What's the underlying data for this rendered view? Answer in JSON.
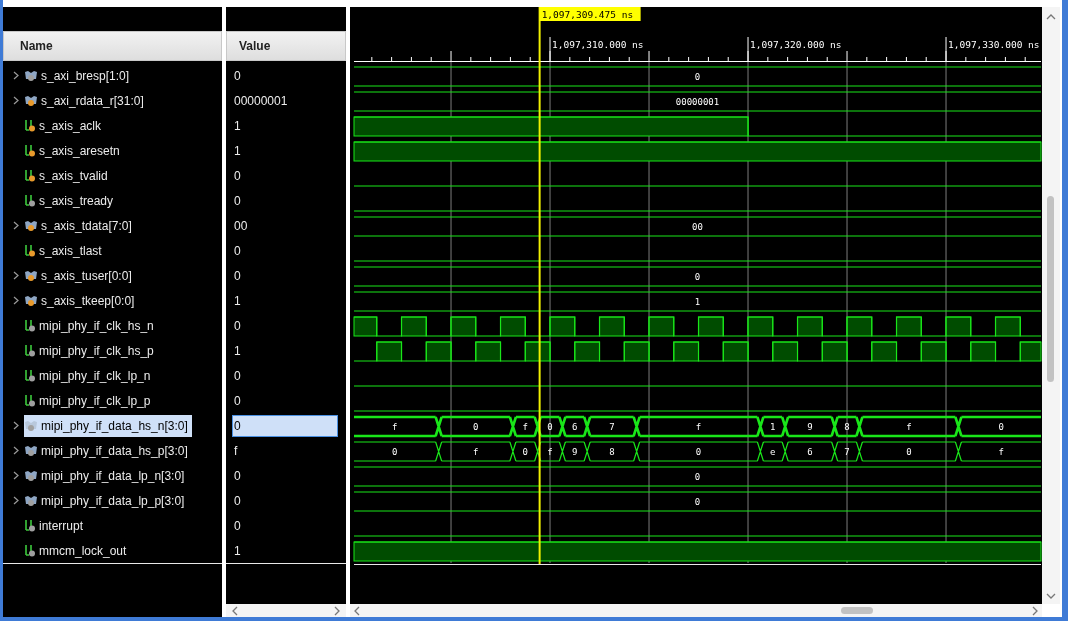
{
  "columns": [
    "Name",
    "Value"
  ],
  "cursor": {
    "label": "1,097,309.475 ns"
  },
  "ruler": [
    "1,097,310.000 ns",
    "1,097,320.000 ns",
    "1,097,330.000 ns"
  ],
  "signals": [
    {
      "name": "s_axi_bresp[1:0]",
      "value": "0",
      "kind": "bus",
      "expanded": false,
      "selected": false,
      "color": "#a0a0a0",
      "segments": [
        "0"
      ]
    },
    {
      "name": "s_axi_rdata_r[31:0]",
      "value": "00000001",
      "kind": "bus",
      "expanded": false,
      "selected": false,
      "color": "#e89a2c",
      "segments": [
        "00000001"
      ]
    },
    {
      "name": "s_axis_aclk",
      "value": "1",
      "kind": "bit",
      "selected": false,
      "color": "#e89a2c"
    },
    {
      "name": "s_axis_aresetn",
      "value": "1",
      "kind": "bit",
      "selected": false,
      "color": "#e89a2c"
    },
    {
      "name": "s_axis_tvalid",
      "value": "0",
      "kind": "bit",
      "selected": false,
      "color": "#e89a2c"
    },
    {
      "name": "s_axis_tready",
      "value": "0",
      "kind": "bit",
      "selected": false,
      "color": "#a0a0a0"
    },
    {
      "name": "s_axis_tdata[7:0]",
      "value": "00",
      "kind": "bus",
      "expanded": false,
      "selected": false,
      "color": "#e89a2c",
      "segments": [
        "00"
      ]
    },
    {
      "name": "s_axis_tlast",
      "value": "0",
      "kind": "bit",
      "selected": false,
      "color": "#e89a2c"
    },
    {
      "name": "s_axis_tuser[0:0]",
      "value": "0",
      "kind": "bus",
      "expanded": false,
      "selected": false,
      "color": "#e89a2c",
      "segments": [
        "0"
      ]
    },
    {
      "name": "s_axis_tkeep[0:0]",
      "value": "1",
      "kind": "bus",
      "expanded": false,
      "selected": false,
      "color": "#e89a2c",
      "segments": [
        "1"
      ]
    },
    {
      "name": "mipi_phy_if_clk_hs_n",
      "value": "0",
      "kind": "bit",
      "selected": false,
      "color": "#a0a0a0"
    },
    {
      "name": "mipi_phy_if_clk_hs_p",
      "value": "1",
      "kind": "bit",
      "selected": false,
      "color": "#a0a0a0"
    },
    {
      "name": "mipi_phy_if_clk_lp_n",
      "value": "0",
      "kind": "bit",
      "selected": false,
      "color": "#a0a0a0"
    },
    {
      "name": "mipi_phy_if_clk_lp_p",
      "value": "0",
      "kind": "bit",
      "selected": false,
      "color": "#a0a0a0"
    },
    {
      "name": "mipi_phy_if_data_hs_n[3:0]",
      "value": "0",
      "kind": "bus",
      "expanded": false,
      "selected": true,
      "color": "#a0a0a0",
      "segments": [
        "f",
        "0",
        "f",
        "0",
        "6",
        "7",
        "f",
        "1",
        "9",
        "8",
        "f",
        "0"
      ]
    },
    {
      "name": "mipi_phy_if_data_hs_p[3:0]",
      "value": "f",
      "kind": "bus",
      "expanded": false,
      "selected": false,
      "color": "#a0a0a0",
      "segments": [
        "0",
        "f",
        "0",
        "f",
        "9",
        "8",
        "0",
        "e",
        "6",
        "7",
        "0",
        "f"
      ]
    },
    {
      "name": "mipi_phy_if_data_lp_n[3:0]",
      "value": "0",
      "kind": "bus",
      "expanded": false,
      "selected": false,
      "color": "#a0a0a0",
      "segments": [
        "0"
      ]
    },
    {
      "name": "mipi_phy_if_data_lp_p[3:0]",
      "value": "0",
      "kind": "bus",
      "expanded": false,
      "selected": false,
      "color": "#a0a0a0",
      "segments": [
        "0"
      ]
    },
    {
      "name": "interrupt",
      "value": "0",
      "kind": "bit",
      "selected": false,
      "color": "#a0a0a0"
    },
    {
      "name": "mmcm_lock_out",
      "value": "1",
      "kind": "bit",
      "selected": false,
      "color": "#a0a0a0"
    }
  ]
}
